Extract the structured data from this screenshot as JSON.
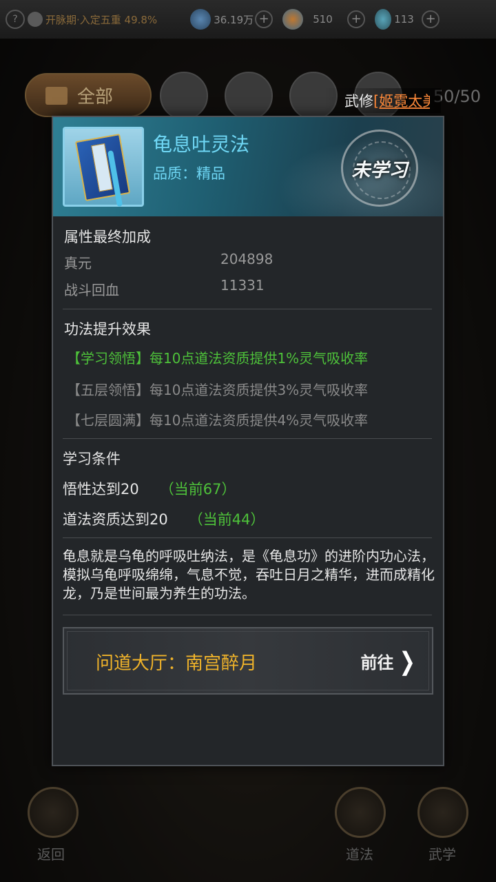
{
  "topbar": {
    "help": "?",
    "realm": "开脉期·入定五重 49.8%",
    "resources": [
      {
        "icon": "spirit-stone-icon",
        "value": "36.19万",
        "plus": "+"
      },
      {
        "icon": "yin-yang-icon",
        "value": "510",
        "plus": "+"
      },
      {
        "icon": "gourd-icon",
        "value": "113",
        "plus": "+"
      }
    ]
  },
  "tabs": {
    "all_label": "全部",
    "count": "50/50"
  },
  "wuxiu": {
    "label": "武修",
    "name": "[姬霓太美"
  },
  "popup": {
    "title": "龟息吐灵法",
    "quality": "品质：精品",
    "status_stamp": "未学习",
    "attr_section": "属性最终加成",
    "attributes": [
      {
        "name": "真元",
        "value": "204898"
      },
      {
        "name": "战斗回血",
        "value": "11331"
      }
    ],
    "effect_section": "功法提升效果",
    "effects": [
      {
        "text": "【学习领悟】每10点道法资质提供1%灵气吸收率",
        "active": true
      },
      {
        "text": "【五层领悟】每10点道法资质提供3%灵气吸收率",
        "active": false
      },
      {
        "text": "【七层圆满】每10点道法资质提供4%灵气吸收率",
        "active": false
      }
    ],
    "cond_section": "学习条件",
    "conditions": [
      {
        "text": "悟性达到20",
        "current": "（当前67）"
      },
      {
        "text": "道法资质达到20",
        "current": "（当前44）"
      }
    ],
    "description": "龟息就是乌龟的呼吸吐纳法，是《龟息功》的进阶内功心法，模拟乌龟呼吸绵绵，气息不觉，吞吐日月之精华，进而成精化龙，乃是世间最为养生的功法。",
    "goto": {
      "hall": "问道大厅：南宫醉月",
      "button": "前往"
    }
  },
  "bottom": {
    "back": "返回",
    "daofa": "道法",
    "wuxue": "武学"
  }
}
